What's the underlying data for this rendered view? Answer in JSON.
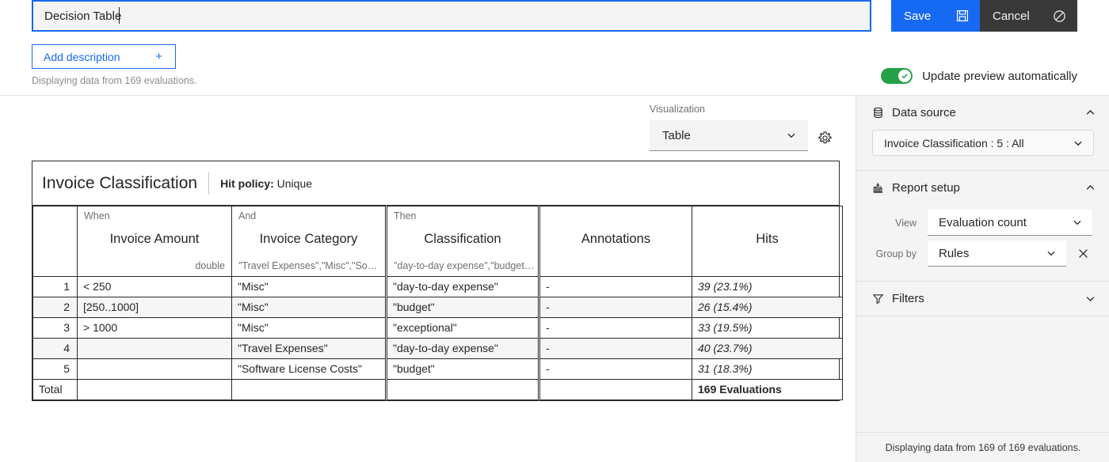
{
  "header": {
    "title_value": "Decision Table",
    "title_placeholder": "Name",
    "save_label": "Save",
    "cancel_label": "Cancel",
    "save_icon": "save-floppy-icon",
    "cancel_icon": "no-entry-icon",
    "save_color": "#1669f3",
    "cancel_color": "#393939"
  },
  "subheader": {
    "add_description_label": "Add description",
    "add_description_icon": "plus-icon",
    "displaying_note": "Displaying data from 169 evaluations.",
    "toggle_label": "Update preview automatically",
    "toggle_state": "on",
    "toggle_color": "#24a148"
  },
  "visualization": {
    "label": "Visualization",
    "value": "Table",
    "chevron_icon": "chevron-down-icon",
    "settings_icon": "gear-icon"
  },
  "decision_table": {
    "name": "Invoice Classification",
    "hit_policy_label": "Hit policy:",
    "hit_policy_value": "Unique",
    "columns": [
      {
        "kind": "",
        "name": "",
        "type": ""
      },
      {
        "kind": "When",
        "name": "Invoice Amount",
        "type": "double",
        "type_align": "right"
      },
      {
        "kind": "And",
        "name": "Invoice Category",
        "type": "\"Travel Expenses\",\"Misc\",\"Soft…",
        "type_align": "left"
      },
      {
        "kind": "Then",
        "name": "Classification",
        "type": "\"day-to-day expense\",\"budget\",…",
        "type_align": "left"
      },
      {
        "kind": "",
        "name": "Annotations",
        "type": ""
      },
      {
        "kind": "",
        "name": "Hits",
        "type": ""
      }
    ],
    "rows": [
      {
        "num": "1",
        "when": "< 250",
        "and": "\"Misc\"",
        "then": "\"day-to-day expense\"",
        "annotations": "-",
        "hits": "39 (23.1%)"
      },
      {
        "num": "2",
        "when": "[250..1000]",
        "and": "\"Misc\"",
        "then": "\"budget\"",
        "annotations": "-",
        "hits": "26 (15.4%)"
      },
      {
        "num": "3",
        "when": "> 1000",
        "and": "\"Misc\"",
        "then": "\"exceptional\"",
        "annotations": "-",
        "hits": "33 (19.5%)"
      },
      {
        "num": "4",
        "when": "",
        "and": "\"Travel Expenses\"",
        "then": "\"day-to-day expense\"",
        "annotations": "-",
        "hits": "40 (23.7%)"
      },
      {
        "num": "5",
        "when": "",
        "and": "\"Software License Costs\"",
        "then": "\"budget\"",
        "annotations": "-",
        "hits": "31 (18.3%)"
      }
    ],
    "total_row": {
      "num": "Total",
      "when": "",
      "and": "",
      "then": "",
      "annotations": "",
      "hits": "169 Evaluations"
    }
  },
  "panel": {
    "data_source": {
      "title": "Data source",
      "icon": "database-icon",
      "collapse_icon": "chevron-up-icon",
      "select_value": "Invoice Classification : 5 : All",
      "select_icon": "chevron-down-icon"
    },
    "report_setup": {
      "title": "Report setup",
      "icon": "bar-chart-icon",
      "collapse_icon": "chevron-up-icon",
      "view_label": "View",
      "view_value": "Evaluation count",
      "group_by_label": "Group by",
      "group_by_value": "Rules",
      "clear_icon": "close-icon",
      "chevron_icon": "chevron-down-icon"
    },
    "filters": {
      "title": "Filters",
      "icon": "funnel-icon",
      "collapse_icon": "chevron-down-icon"
    },
    "footer_text": "Displaying data from 169 of 169 evaluations."
  }
}
